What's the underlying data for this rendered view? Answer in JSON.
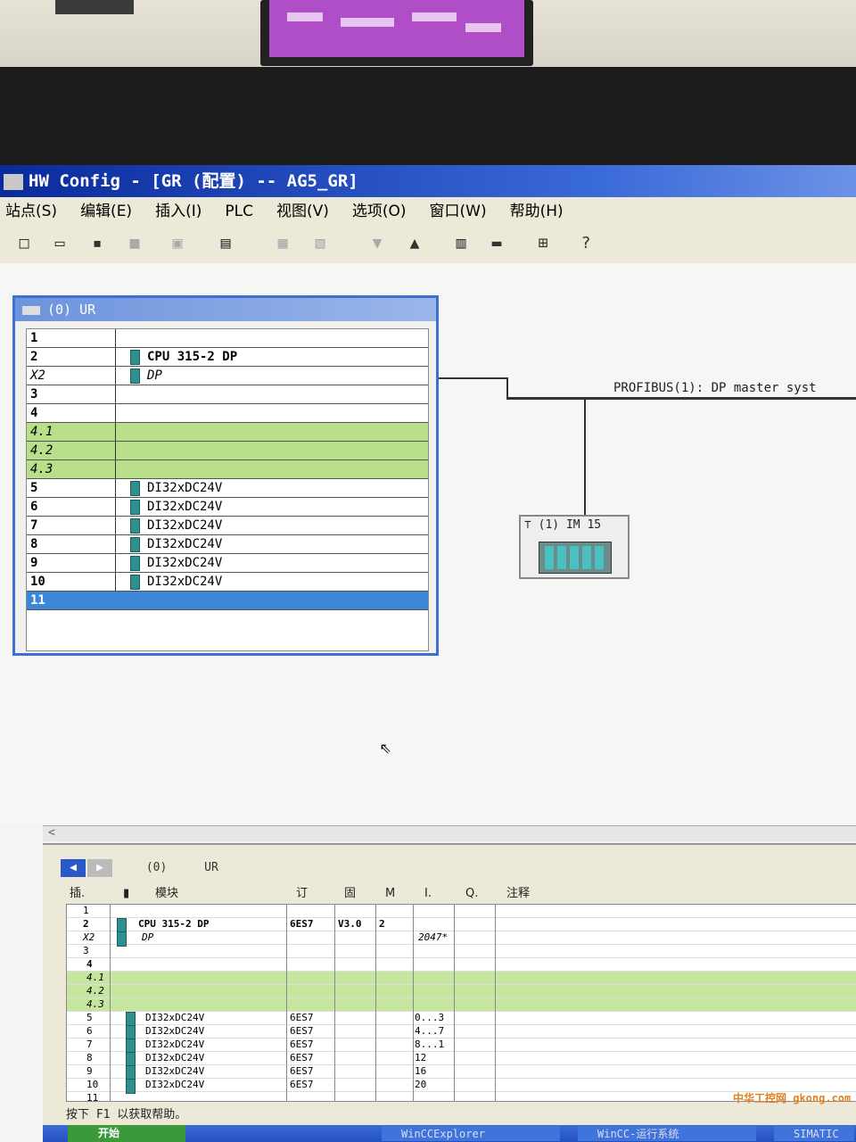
{
  "window": {
    "title": "HW Config - [GR (配置) -- AG5_GR]"
  },
  "menu": [
    "站点(S)",
    "编辑(E)",
    "插入(I)",
    "PLC",
    "视图(V)",
    "选项(O)",
    "窗口(W)",
    "帮助(H)"
  ],
  "rack": {
    "title": "(0) UR",
    "rows": [
      {
        "slot": "1",
        "module": ""
      },
      {
        "slot": "2",
        "module": "CPU 315-2 DP"
      },
      {
        "slot": "X2",
        "module": "DP"
      },
      {
        "slot": "3",
        "module": ""
      },
      {
        "slot": "4",
        "module": ""
      },
      {
        "slot": "4.1",
        "module": ""
      },
      {
        "slot": "4.2",
        "module": ""
      },
      {
        "slot": "4.3",
        "module": ""
      },
      {
        "slot": "5",
        "module": "DI32xDC24V"
      },
      {
        "slot": "6",
        "module": "DI32xDC24V"
      },
      {
        "slot": "7",
        "module": "DI32xDC24V"
      },
      {
        "slot": "8",
        "module": "DI32xDC24V"
      },
      {
        "slot": "9",
        "module": "DI32xDC24V"
      },
      {
        "slot": "10",
        "module": "DI32xDC24V"
      },
      {
        "slot": "11",
        "module": ""
      }
    ]
  },
  "network": {
    "bus_label": "PROFIBUS(1): DP master syst",
    "slave_label": "(1) IM 15"
  },
  "detail": {
    "rack_label": "(0)",
    "rack_name": "UR",
    "columns": [
      "插.",
      "模块",
      "订",
      "固",
      "M",
      "I.",
      "Q.",
      "注释"
    ],
    "rows": [
      {
        "slot": "1",
        "module": "",
        "order": "",
        "fw": "",
        "mpi": "",
        "i": ""
      },
      {
        "slot": "2",
        "module": "CPU 315-2 DP",
        "order": "6ES7",
        "fw": "V3.0",
        "mpi": "2",
        "i": ""
      },
      {
        "slot": "X2",
        "module": "DP",
        "order": "",
        "fw": "",
        "mpi": "",
        "i": "2047*"
      },
      {
        "slot": "3",
        "module": "",
        "order": "",
        "fw": "",
        "mpi": "",
        "i": ""
      },
      {
        "slot": "4",
        "module": "",
        "order": "",
        "fw": "",
        "mpi": "",
        "i": ""
      },
      {
        "slot": "4.1",
        "module": "",
        "order": "",
        "fw": "",
        "mpi": "",
        "i": ""
      },
      {
        "slot": "4.2",
        "module": "",
        "order": "",
        "fw": "",
        "mpi": "",
        "i": ""
      },
      {
        "slot": "4.3",
        "module": "",
        "order": "",
        "fw": "",
        "mpi": "",
        "i": ""
      },
      {
        "slot": "5",
        "module": "DI32xDC24V",
        "order": "6ES7",
        "fw": "",
        "mpi": "",
        "i": "0...3"
      },
      {
        "slot": "6",
        "module": "DI32xDC24V",
        "order": "6ES7",
        "fw": "",
        "mpi": "",
        "i": "4...7"
      },
      {
        "slot": "7",
        "module": "DI32xDC24V",
        "order": "6ES7",
        "fw": "",
        "mpi": "",
        "i": "8...1"
      },
      {
        "slot": "8",
        "module": "DI32xDC24V",
        "order": "6ES7",
        "fw": "",
        "mpi": "",
        "i": "12"
      },
      {
        "slot": "9",
        "module": "DI32xDC24V",
        "order": "6ES7",
        "fw": "",
        "mpi": "",
        "i": "16"
      },
      {
        "slot": "10",
        "module": "DI32xDC24V",
        "order": "6ES7",
        "fw": "",
        "mpi": "",
        "i": "20"
      },
      {
        "slot": "11",
        "module": "",
        "order": "",
        "fw": "",
        "mpi": "",
        "i": ""
      }
    ]
  },
  "status": "按下 F1 以获取帮助。",
  "taskbar": {
    "start": "开始",
    "tasks": [
      "WinCCExplorer",
      "WinCC-运行系统",
      "SIMATIC"
    ]
  },
  "watermark": "中华工控网 gkong.com"
}
